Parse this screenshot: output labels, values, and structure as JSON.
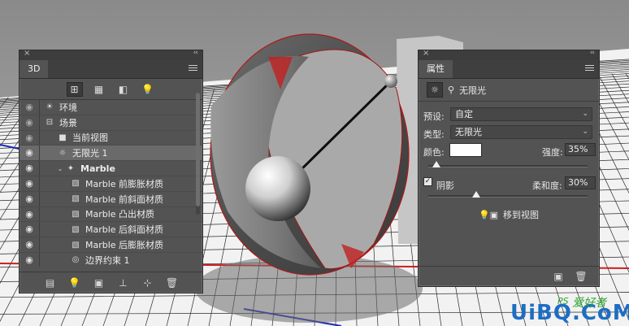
{
  "panel3d": {
    "tab_title": "3D",
    "close_glyph": "×",
    "collapse_glyph": "‹‹",
    "filters": [
      {
        "icon": "scene-filter-icon",
        "glyph": "⊞",
        "active": true
      },
      {
        "icon": "mesh-filter-icon",
        "glyph": "▦",
        "active": false
      },
      {
        "icon": "material-filter-icon",
        "glyph": "◧",
        "active": false
      },
      {
        "icon": "light-filter-icon",
        "glyph": "💡",
        "active": false
      }
    ],
    "layers": [
      {
        "label": "环境",
        "icon": "environment-icon",
        "glyph": "☀",
        "indent": 0,
        "eye_dim": true
      },
      {
        "label": "场景",
        "icon": "scene-icon",
        "glyph": "⊟",
        "indent": 0,
        "eye_dim": true
      },
      {
        "label": "当前视图",
        "icon": "camera-icon",
        "glyph": "■",
        "indent": 1,
        "eye_dim": true
      },
      {
        "label": "无限光 1",
        "icon": "infinite-light-icon",
        "glyph": "☼",
        "indent": 1,
        "selected": true,
        "eye_dim": false
      },
      {
        "label": "Marble",
        "icon": "mesh-icon",
        "glyph": "✦",
        "indent": 1,
        "twisty": "v",
        "bold": true,
        "eye_dim": false
      },
      {
        "label": "Marble 前膨胀材质",
        "icon": "material-icon",
        "glyph": "▧",
        "indent": 2,
        "eye_dim": false
      },
      {
        "label": "Marble 前斜面材质",
        "icon": "material-icon",
        "glyph": "▧",
        "indent": 2,
        "eye_dim": false
      },
      {
        "label": "Marble 凸出材质",
        "icon": "material-icon",
        "glyph": "▧",
        "indent": 2,
        "eye_dim": false
      },
      {
        "label": "Marble 后斜面材质",
        "icon": "material-icon",
        "glyph": "▧",
        "indent": 2,
        "eye_dim": false
      },
      {
        "label": "Marble 后膨胀材质",
        "icon": "material-icon",
        "glyph": "▧",
        "indent": 2,
        "eye_dim": false
      },
      {
        "label": "边界约束 1",
        "icon": "constraint-icon",
        "glyph": "◎",
        "indent": 2,
        "eye_dim": false
      }
    ],
    "footer": [
      {
        "icon": "render-icon",
        "glyph": "▤"
      },
      {
        "icon": "add-light-icon",
        "glyph": "💡"
      },
      {
        "icon": "new-object-icon",
        "glyph": "▣"
      },
      {
        "icon": "drop-to-ground-icon",
        "glyph": "⊥"
      },
      {
        "icon": "add-constraint-icon",
        "glyph": "⊹"
      },
      {
        "icon": "delete-icon",
        "glyph": "🗑"
      }
    ]
  },
  "properties": {
    "tab_title": "属性",
    "close_glyph": "×",
    "collapse_glyph": "‹‹",
    "head_label": "无限光",
    "preset_label": "预设:",
    "preset_value": "自定",
    "type_label": "类型:",
    "type_value": "无限光",
    "color_label": "颜色:",
    "color_value": "#ffffff",
    "intensity_label": "强度:",
    "intensity_value": "35%",
    "intensity_fraction": 0.05,
    "shadow_label": "阴影",
    "shadow_checked": true,
    "softness_label": "柔和度:",
    "softness_value": "30%",
    "softness_fraction": 0.3,
    "move_to_view_label": "移到视图",
    "footer": [
      {
        "icon": "render-preview-icon",
        "glyph": "▣"
      },
      {
        "icon": "delete-icon",
        "glyph": "🗑"
      }
    ]
  },
  "watermark": {
    "latin": "UiBQ.CoM",
    "small": "PS",
    "cn": "爱好者"
  },
  "colors": {
    "panel_bg": "#535353",
    "panel_dark": "#3f3f3f",
    "floor_light": "#f2f2f2",
    "floor_line": "#2a2a2a",
    "axis_red": "#cc1f1f",
    "axis_blue": "#1d2ab8",
    "watermark_blue": "#1c6ec4",
    "watermark_green": "#2fa52f"
  }
}
